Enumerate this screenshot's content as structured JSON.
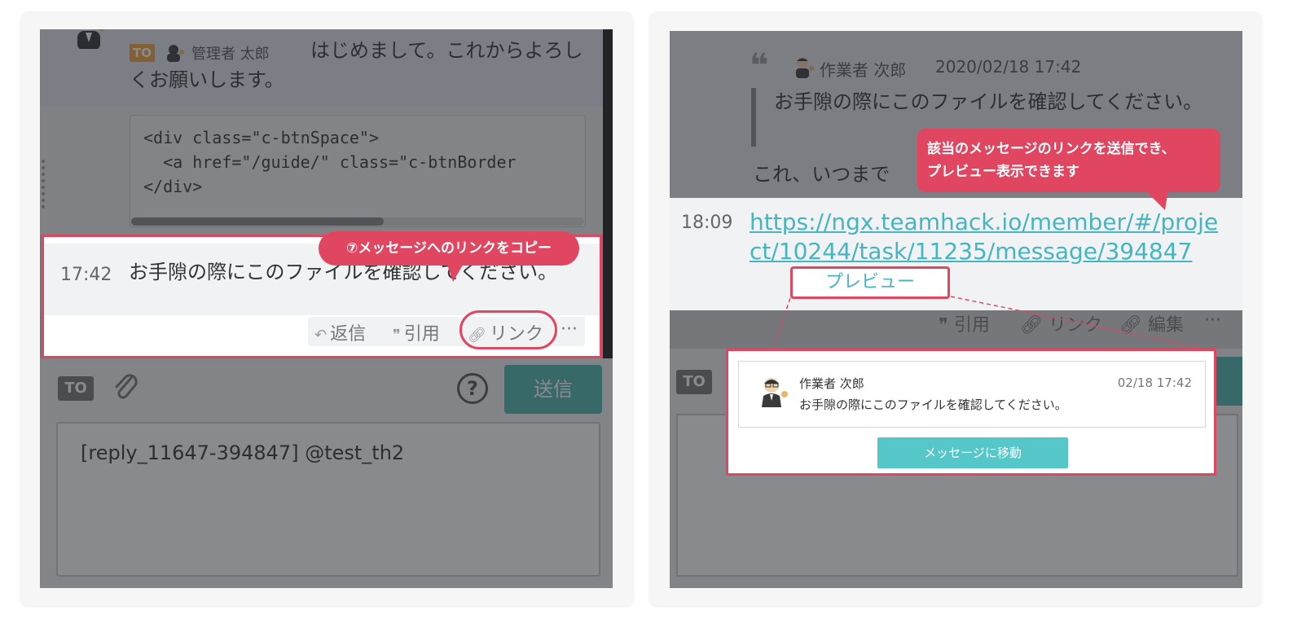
{
  "left": {
    "top_message": {
      "to_label": "TO",
      "to_name": "管理者 太郎",
      "text": "はじめまして。これからよろしくお願いします。"
    },
    "code_lines": [
      "<div class=\"c-btnSpace\">",
      "  <a href=\"/guide/\" class=\"c-btnBorder",
      "</div>"
    ],
    "highlight_message": {
      "time": "17:42",
      "text": "お手隙の際にこのファイルを確認してください。"
    },
    "actions": {
      "reply": "返信",
      "quote": "引用",
      "link": "リンク",
      "more": "···"
    },
    "callout": "⑦メッセージへのリンクをコピー",
    "composer": {
      "to_label": "TO",
      "help": "?",
      "send": "送信",
      "value": "[reply_11647-394847] @test_th2"
    }
  },
  "right": {
    "quoted": {
      "name": "作業者 次郎",
      "date": "2020/02/18 17:42",
      "text": "お手隙の際にこのファイルを確認してください。",
      "after": "これ、いつまで"
    },
    "link_message": {
      "time": "18:09",
      "url": "https://ngx.teamhack.io/member/#/project/10244/task/11235/message/394847",
      "preview_button": "プレビュー"
    },
    "actions": {
      "quote": "引用",
      "link": "リンク",
      "edit": "編集",
      "more": "···"
    },
    "composer": {
      "to_label": "TO"
    },
    "callout_line1": "該当のメッセージのリンクを送信でき、",
    "callout_line2": "プレビュー表示できます",
    "preview": {
      "name": "作業者 次郎",
      "date": "02/18 17:42",
      "text": "お手隙の際にこのファイルを確認してください。",
      "button": "メッセージに移動"
    }
  },
  "colors": {
    "accent_red": "#e14661",
    "teal": "#49b7b0",
    "link": "#46b5c1"
  }
}
